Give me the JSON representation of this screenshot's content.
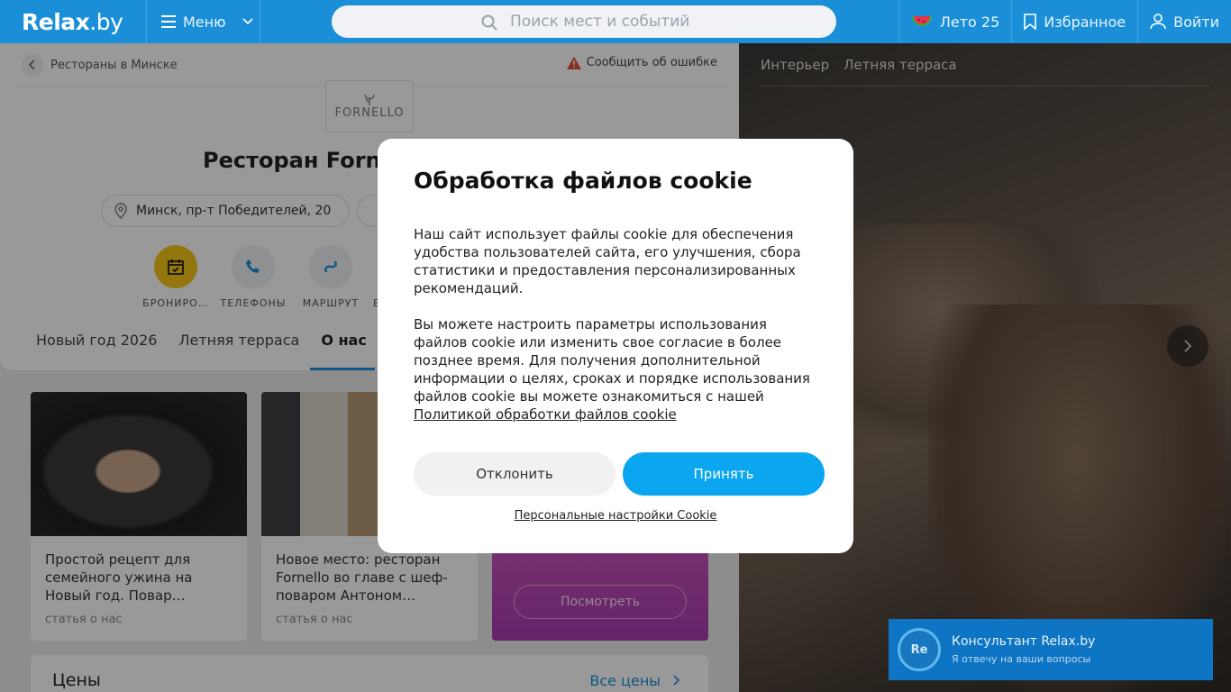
{
  "header": {
    "logo_main": "Relax",
    "logo_suffix": ".by",
    "menu_label": "Меню",
    "search_placeholder": "Поиск мест и событий",
    "summer_label": "Лето 25",
    "favorites_label": "Избранное",
    "login_label": "Войти"
  },
  "place": {
    "breadcrumb": "Рестораны в Минске",
    "report_label": "Сообщить об ошибке",
    "logo_text": "FORNELLO",
    "title": "Ресторан Fornello",
    "address": "Минск, пр-т Победителей, 20",
    "actions": [
      {
        "label": "БРОНИРО…"
      },
      {
        "label": "ТЕЛЕФОНЫ"
      },
      {
        "label": "МАРШРУТ"
      },
      {
        "label": "В"
      }
    ],
    "tabs": [
      "Новый год 2026",
      "Летняя терраса",
      "О нас"
    ],
    "active_tab": "О нас"
  },
  "articles": [
    {
      "title": "Простой рецепт для семейного ужина на Новый год. Повар…",
      "tag": "статья о нас"
    },
    {
      "title": "Новое место: ресторан Fornello во главе с шеф-поваром Антоном…",
      "tag": "статья о нас"
    }
  ],
  "promo_button": "Посмотреть",
  "prices": {
    "heading": "Цены",
    "all_link": "Все цены"
  },
  "gallery": {
    "tabs": [
      "Интерьер",
      "Летняя терраса"
    ]
  },
  "cookie": {
    "title": "Обработка файлов cookie",
    "para1": "Наш сайт использует файлы cookie для обеспечения удобства пользователей сайта, его улучшения, сбора статистики и предоставления персонализированных рекомендаций.",
    "para2": "Вы можете настроить параметры использования файлов cookie или изменить свое согласие в более позднее время. Для получения дополнительной информации о целях, сроках и порядке использования файлов cookie вы можете ознакомиться с нашей",
    "policy_link": "Политикой обработки файлов cookie",
    "decline_label": "Отклонить",
    "accept_label": "Принять",
    "settings_link": "Персональные настройки Cookie"
  },
  "consultant": {
    "avatar": "Re",
    "name": "Консультант Relax.by",
    "subtitle": "Я отвечу на ваши вопросы"
  },
  "colors": {
    "brand": "#1a8fd8",
    "accept": "#0aa6ef",
    "booking": "#f5c518"
  }
}
